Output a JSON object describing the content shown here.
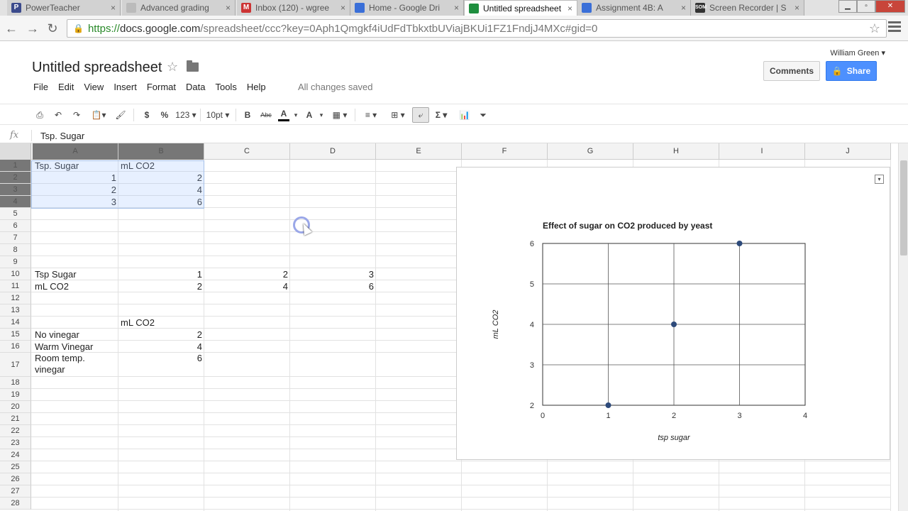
{
  "browser": {
    "tabs": [
      {
        "label": "PowerTeacher",
        "active": false,
        "icon": "powerteacher-icon"
      },
      {
        "label": "Advanced grading",
        "active": false,
        "icon": "page-icon"
      },
      {
        "label": "Inbox (120) - wgree",
        "active": false,
        "icon": "gmail-icon"
      },
      {
        "label": "Home - Google Dri",
        "active": false,
        "icon": "docs-icon"
      },
      {
        "label": "Untitled spreadsheet",
        "active": true,
        "icon": "sheets-icon"
      },
      {
        "label": "Assignment 4B: A",
        "active": false,
        "icon": "docs-icon"
      },
      {
        "label": "Screen Recorder | S",
        "active": false,
        "icon": "som-icon"
      }
    ],
    "url_prefix": "https://",
    "url_host": "docs.google.com",
    "url_path": "/spreadsheet/ccc?key=0Aph1Qmgkf4iUdFdTbkxtbUViajBKUi1FZ1FndjJ4MXc#gid=0"
  },
  "docs": {
    "user": "William Green",
    "title": "Untitled spreadsheet",
    "comments_label": "Comments",
    "share_label": "Share",
    "menu": [
      "File",
      "Edit",
      "View",
      "Insert",
      "Format",
      "Data",
      "Tools",
      "Help"
    ],
    "saved_status": "All changes saved"
  },
  "toolbar": {
    "currency": "$",
    "percent": "%",
    "number_format": "123",
    "font_size": "10pt",
    "bold": "B",
    "strikethrough": "Abc",
    "text_color": "A",
    "fill_color": "A",
    "sum": "Σ"
  },
  "formula_bar": {
    "fx": "fx",
    "value": "Tsp. Sugar"
  },
  "sheet": {
    "columns": [
      "A",
      "B",
      "C",
      "D",
      "E",
      "F",
      "G",
      "H",
      "I",
      "J"
    ],
    "rows": [
      "1",
      "2",
      "3",
      "4",
      "5",
      "6",
      "7",
      "8",
      "9",
      "10",
      "11",
      "12",
      "13",
      "14",
      "15",
      "16",
      "17",
      "18",
      "19",
      "20",
      "21",
      "22",
      "23",
      "24",
      "25",
      "26",
      "27",
      "28"
    ],
    "cells": {
      "A1": "Tsp. Sugar",
      "B1": "mL CO2",
      "A2": "1",
      "B2": "2",
      "A3": "2",
      "B3": "4",
      "A4": "3",
      "B4": "6",
      "A10": "Tsp Sugar",
      "B10": "1",
      "C10": "2",
      "D10": "3",
      "A11": "mL CO2",
      "B11": "2",
      "C11": "4",
      "D11": "6",
      "B14": "mL CO2",
      "A15": "No vinegar",
      "B15": "2",
      "A16": "Warm Vinegar",
      "B16": "4",
      "A17": "Room temp. vinegar",
      "B17": "6"
    }
  },
  "chart_data": {
    "type": "scatter",
    "title": "Effect of sugar on CO2 produced by yeast",
    "xlabel": "tsp sugar",
    "ylabel": "mL CO2",
    "xlim": [
      0,
      4
    ],
    "ylim": [
      2,
      6
    ],
    "xticks": [
      "0",
      "1",
      "2",
      "3",
      "4"
    ],
    "yticks": [
      "2",
      "3",
      "4",
      "5",
      "6"
    ],
    "grid": true,
    "point_color": "#2d4a7a",
    "points": [
      {
        "x": 1,
        "y": 2
      },
      {
        "x": 2,
        "y": 4
      },
      {
        "x": 3,
        "y": 6
      }
    ]
  }
}
